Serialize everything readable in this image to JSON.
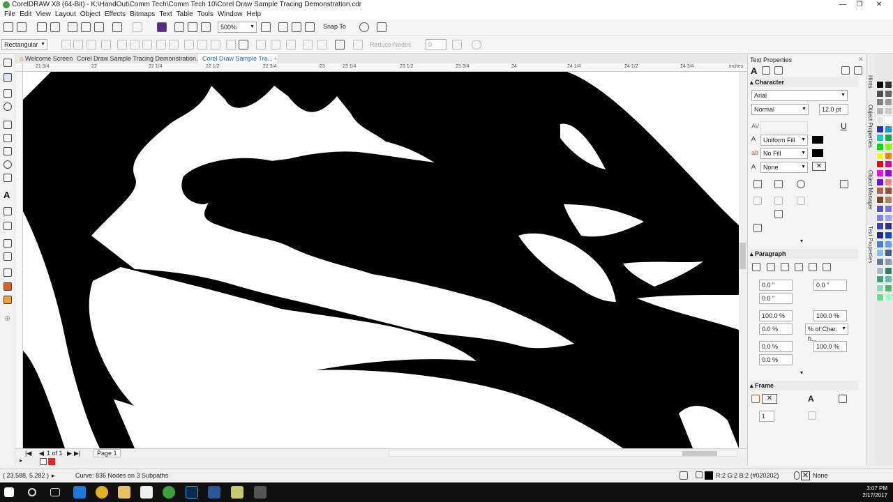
{
  "window": {
    "title": "CorelDRAW X8 (64-Bit) - K:\\HandOut\\Comm Tech\\Comm Tech 10\\Corel Draw Sample Tracing Demonstration.cdr"
  },
  "menu": [
    "File",
    "Edit",
    "View",
    "Layout",
    "Object",
    "Effects",
    "Bitmaps",
    "Text",
    "Table",
    "Tools",
    "Window",
    "Help"
  ],
  "toolbar": {
    "zoom": "500%",
    "snap_label": "Snap To"
  },
  "propbar": {
    "shape_mode": "Rectangular",
    "reduce_nodes": "Reduce Nodes",
    "smoothing": "0"
  },
  "tabs": [
    {
      "label": "Welcome Screen"
    },
    {
      "label": "Corel Draw Sample Tracing Demonstration.cdr"
    },
    {
      "label": "Corel Draw Sample Tra..."
    }
  ],
  "ruler": {
    "ticks": [
      "21 3/4",
      "22",
      "22 1/4",
      "22 1/2",
      "22 3/4",
      "23",
      "23 1/4",
      "23 1/2",
      "23 3/4",
      "24",
      "24 1/4",
      "24 1/2",
      "24 3/4"
    ],
    "unit": "inches"
  },
  "pagebar": {
    "count": "1 of 1",
    "page": "Page 1"
  },
  "status": {
    "coords": "( 23.588, 5.282 )",
    "info": "Curve: 836 Nodes on 3 Subpaths",
    "fill_color": "R:2 G:2 B:2 (#020202)",
    "outline": "None"
  },
  "docker": {
    "title": "Text Properties",
    "character": {
      "heading": "Character",
      "font": "Arial",
      "style": "Normal",
      "size": "12.0 pt",
      "fill": "Uniform Fill",
      "background": "No Fill",
      "outline": "None"
    },
    "paragraph": {
      "heading": "Paragraph",
      "indent_left": "0.0 \"",
      "indent_first": "0.0 \"",
      "indent_right": "0.0 \"",
      "line_spacing": "100.0 %",
      "char_spacing": "100.0 %",
      "before": "0.0 %",
      "spacing_unit": "% of Char. h...",
      "after": "0.0 %",
      "word_spacing": "100.0 %",
      "lang_spacing": "0.0 %"
    },
    "frame": {
      "heading": "Frame",
      "columns": "1"
    }
  },
  "vertical_tabs": [
    "Hints",
    "Object Properties",
    "Object Manager",
    "Text Properties"
  ],
  "palette": [
    "#000000",
    "#333333",
    "#4d4d4d",
    "#666666",
    "#808080",
    "#999999",
    "#b3b3b3",
    "#cccccc",
    "#e6e6e6",
    "#ffffff",
    "#2b2bd0",
    "#00a0e0",
    "#00d0d0",
    "#00b050",
    "#00e000",
    "#80ff00",
    "#ffff00",
    "#ff8000",
    "#ff0000",
    "#e000a0",
    "#ff00ff",
    "#a000e0",
    "#8000ff",
    "#ff8080",
    "#c06040",
    "#a05030",
    "#804020",
    "#b08060",
    "#5050d0",
    "#7070e0",
    "#8080ff",
    "#a0a0ff",
    "#4040a0",
    "#303080",
    "#2020a0",
    "#0050c0",
    "#4080e0",
    "#60a0f0",
    "#80c0ff",
    "#406080",
    "#608090",
    "#80a0b0",
    "#a0c0d0",
    "#308060",
    "#40a080",
    "#60c0a0",
    "#80e0c0",
    "#40c060",
    "#60e080",
    "#a0ffc0"
  ],
  "taskbar": {
    "time": "3:07 PM",
    "date": "2/17/2017"
  }
}
